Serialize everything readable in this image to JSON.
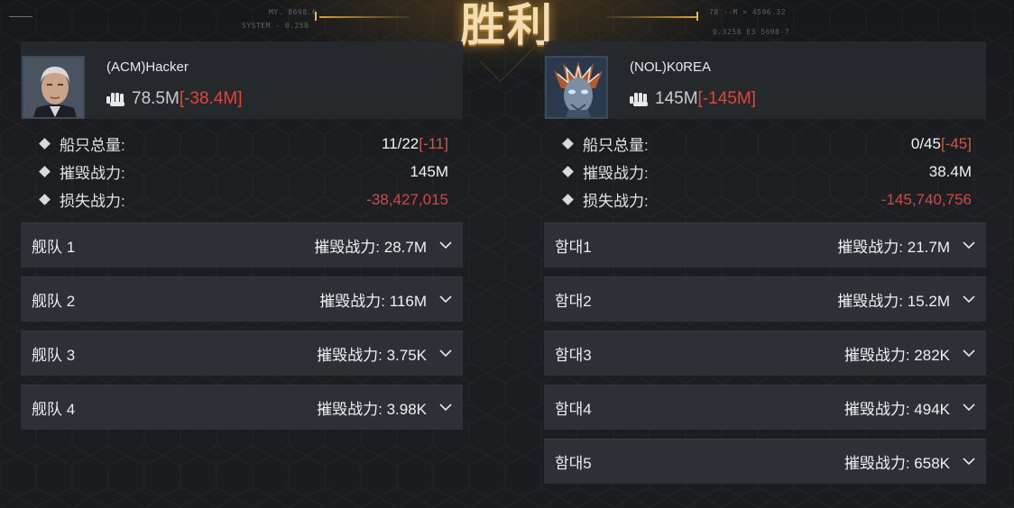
{
  "banner": {
    "title": "胜利"
  },
  "hud": {
    "left_top": "MY. 8698.6",
    "left_bottom": "SYSTEM - 0.25B",
    "right_top": "78 --M > 4596.32",
    "right_bottom": "0.3258  E3 5698-7"
  },
  "icons": {
    "power": "fist-icon",
    "stat": "diamond-bullet-icon",
    "expand": "chevron-down-icon"
  },
  "colors": {
    "accent_gold": "#e5b84a",
    "loss_red": "#e5443b",
    "panel": "#2d3034"
  },
  "labels": {
    "ships_total": "船只总量:",
    "destroyed_power": "摧毁战力:",
    "lost_power": "损失战力:"
  },
  "left": {
    "name": "(ACM)Hacker",
    "power": "78.5M",
    "power_delta": "[-38.4M]",
    "ships": "11/22",
    "ships_delta": "[-11]",
    "destroyed": "145M",
    "lost": "-38,427,015",
    "fleets": [
      {
        "name": "舰队 1",
        "power": "摧毁战力: 28.7M"
      },
      {
        "name": "舰队 2",
        "power": "摧毁战力: 116M"
      },
      {
        "name": "舰队 3",
        "power": "摧毁战力: 3.75K"
      },
      {
        "name": "舰队 4",
        "power": "摧毁战力: 3.98K"
      }
    ]
  },
  "right": {
    "name": "(NOL)K0REA",
    "power": "145M",
    "power_delta": "[-145M]",
    "ships": "0/45",
    "ships_delta": "[-45]",
    "destroyed": "38.4M",
    "lost": "-145,740,756",
    "fleets": [
      {
        "name": "함대1",
        "power": "摧毁战力: 21.7M"
      },
      {
        "name": "함대2",
        "power": "摧毁战力: 15.2M"
      },
      {
        "name": "함대3",
        "power": "摧毁战力: 282K"
      },
      {
        "name": "함대4",
        "power": "摧毁战力: 494K"
      },
      {
        "name": "함대5",
        "power": "摧毁战力: 658K"
      }
    ]
  }
}
